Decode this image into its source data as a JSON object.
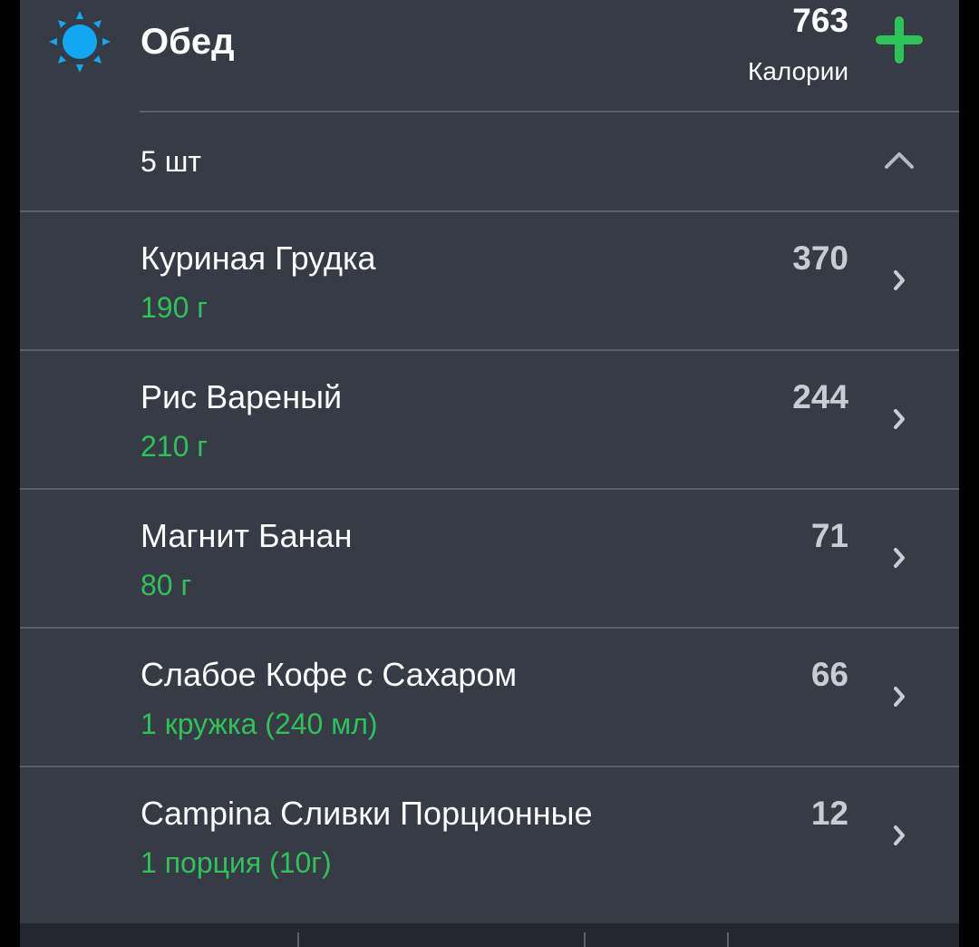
{
  "meal": {
    "title": "Обед",
    "icon": "sun-icon",
    "total_calories": "763",
    "calories_label": "Калории",
    "add_icon": "plus-icon",
    "count_label": "5 шт",
    "collapse_icon": "chevron-up-icon"
  },
  "items": [
    {
      "name": "Куриная Грудка",
      "amount": "190 г",
      "calories": "370"
    },
    {
      "name": "Рис Вареный",
      "amount": "210 г",
      "calories": "244"
    },
    {
      "name": "Магнит Банан",
      "amount": "80 г",
      "calories": "71"
    },
    {
      "name": "Слабое Кофе с Сахаром",
      "amount": "1 кружка (240 мл)",
      "calories": "66"
    },
    {
      "name": "Campina Сливки Порционные",
      "amount": "1 порция (10г)",
      "calories": "12"
    }
  ],
  "colors": {
    "card_background": "#373b46",
    "accent_green": "#2ec25a",
    "sun_blue": "#10a8f0",
    "divider": "#5c616c"
  }
}
